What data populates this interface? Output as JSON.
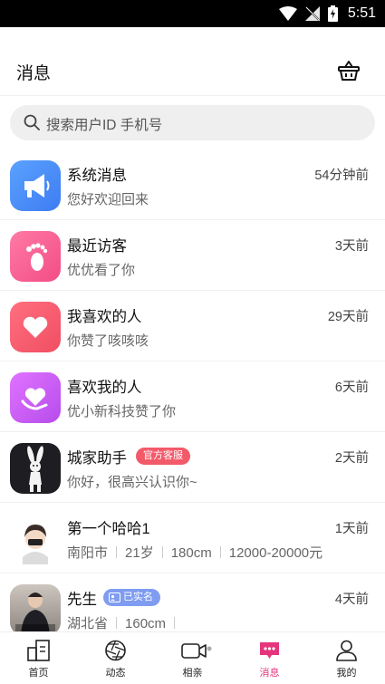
{
  "status_bar": {
    "time": "5:51"
  },
  "header": {
    "title": "消息",
    "basket_icon": "basket-icon"
  },
  "search": {
    "placeholder": "搜索用户ID 手机号"
  },
  "system_rows": [
    {
      "name": "系统消息",
      "sub": "您好欢迎回来",
      "time": "54分钟前",
      "icon": "megaphone-icon",
      "color": "#4c8ef7"
    },
    {
      "name": "最近访客",
      "sub": "优优看了你",
      "time": "3天前",
      "icon": "footprint-icon",
      "color": "#f4608f"
    },
    {
      "name": "我喜欢的人",
      "sub": "你赞了咳咳咳",
      "time": "29天前",
      "icon": "heart-icon",
      "color": "#f65a6d"
    },
    {
      "name": "喜欢我的人",
      "sub": "优小新科技赞了你",
      "time": "6天前",
      "icon": "heart-hand-icon",
      "color": "#c85cf0"
    }
  ],
  "assistant_row": {
    "name": "城家助手",
    "badge": "官方客服",
    "sub": "你好，很高兴认识你~",
    "time": "2天前"
  },
  "user_rows": [
    {
      "name": "第一个哈哈1",
      "time": "1天前",
      "details": [
        "南阳市",
        "21岁",
        "180cm",
        "12000-20000元"
      ]
    },
    {
      "name": "先生",
      "badge": "已实名",
      "time": "4天前",
      "details": [
        "湖北省",
        "160cm"
      ]
    }
  ],
  "tabbar": [
    {
      "label": "首页",
      "icon": "home-icon"
    },
    {
      "label": "动态",
      "icon": "camera-aperture-icon"
    },
    {
      "label": "相亲",
      "icon": "video-icon"
    },
    {
      "label": "消息",
      "icon": "message-icon",
      "active": true
    },
    {
      "label": "我的",
      "icon": "person-icon"
    }
  ],
  "colors": {
    "accent": "#e5357c",
    "badge_red": "#f25a6a",
    "badge_blue": "#7f9cf1"
  }
}
